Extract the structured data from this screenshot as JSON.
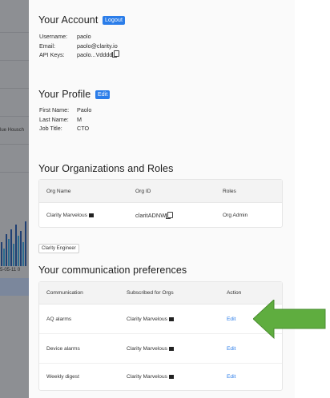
{
  "background_app": {
    "truncated_label": "lue Housch",
    "date_fragment": "5-05-11 0"
  },
  "account": {
    "title": "Your Account",
    "logout_label": "Logout",
    "fields": [
      {
        "label": "Username:",
        "value": "paolo"
      },
      {
        "label": "Email:",
        "value": "paolo@clarity.io"
      },
      {
        "label": "API Keys:",
        "value": "paolo...Vdddd"
      }
    ]
  },
  "profile": {
    "title": "Your Profile",
    "edit_label": "Edit",
    "fields": [
      {
        "label": "First Name:",
        "value": "Paolo"
      },
      {
        "label": "Last Name:",
        "value": "M"
      },
      {
        "label": "Job Title:",
        "value": "CTO"
      }
    ]
  },
  "orgs": {
    "title": "Your Organizations and Roles",
    "columns": [
      "Org Name",
      "Org ID",
      "Roles"
    ],
    "rows": [
      {
        "name": "Clarity Marvelous",
        "id": "claritADNW",
        "role": "Org Admin"
      }
    ]
  },
  "badge": "Clarity Engineer",
  "comm": {
    "title": "Your communication preferences",
    "columns": [
      "Communication",
      "Subscribed for Orgs",
      "Action"
    ],
    "rows": [
      {
        "type": "AQ alarms",
        "org": "Clarity Marvelous",
        "action": "Edit"
      },
      {
        "type": "Device alarms",
        "org": "Clarity Marvelous",
        "action": "Edit"
      },
      {
        "type": "Weekly digest",
        "org": "Clarity Marvelous",
        "action": "Edit"
      }
    ]
  },
  "colors": {
    "accent": "#2b7de9",
    "arrow": "#5fad3f"
  }
}
